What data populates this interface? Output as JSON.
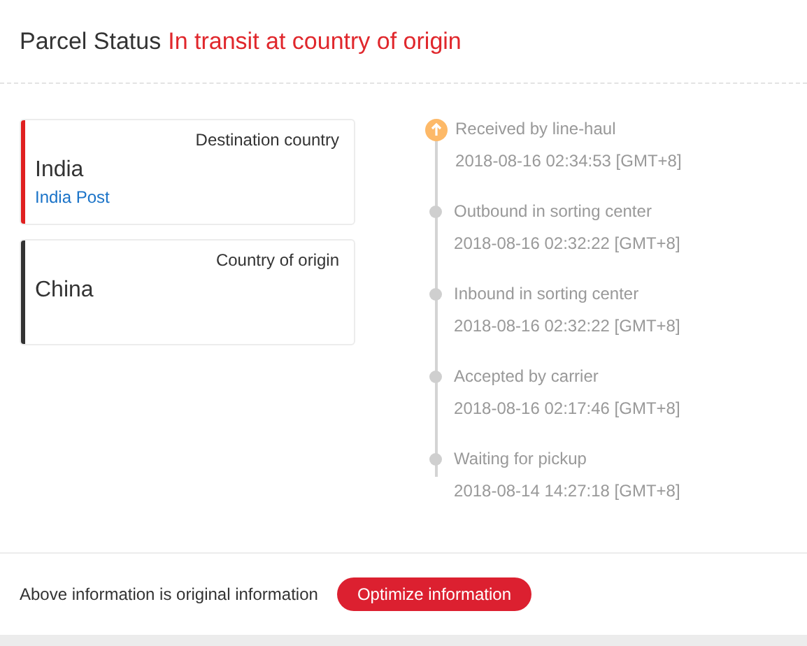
{
  "header": {
    "title": "Parcel Status",
    "status": "In transit at country of origin"
  },
  "countries": [
    {
      "label": "Destination country",
      "name": "India",
      "carrier": "India Post",
      "color": "#e02020"
    },
    {
      "label": "Country of origin",
      "name": "China",
      "color": "#333333"
    }
  ],
  "events": [
    {
      "title": "Received by line-haul",
      "time": "2018-08-16 02:34:53 [GMT+8]",
      "latest": true
    },
    {
      "title": "Outbound in sorting center",
      "time": "2018-08-16 02:32:22 [GMT+8]",
      "latest": false
    },
    {
      "title": "Inbound in sorting center",
      "time": "2018-08-16 02:32:22 [GMT+8]",
      "latest": false
    },
    {
      "title": "Accepted by carrier",
      "time": "2018-08-16 02:17:46 [GMT+8]",
      "latest": false
    },
    {
      "title": "Waiting for pickup",
      "time": "2018-08-14 14:27:18 [GMT+8]",
      "latest": false
    }
  ],
  "footer": {
    "note": "Above information is original information",
    "button": "Optimize information"
  }
}
